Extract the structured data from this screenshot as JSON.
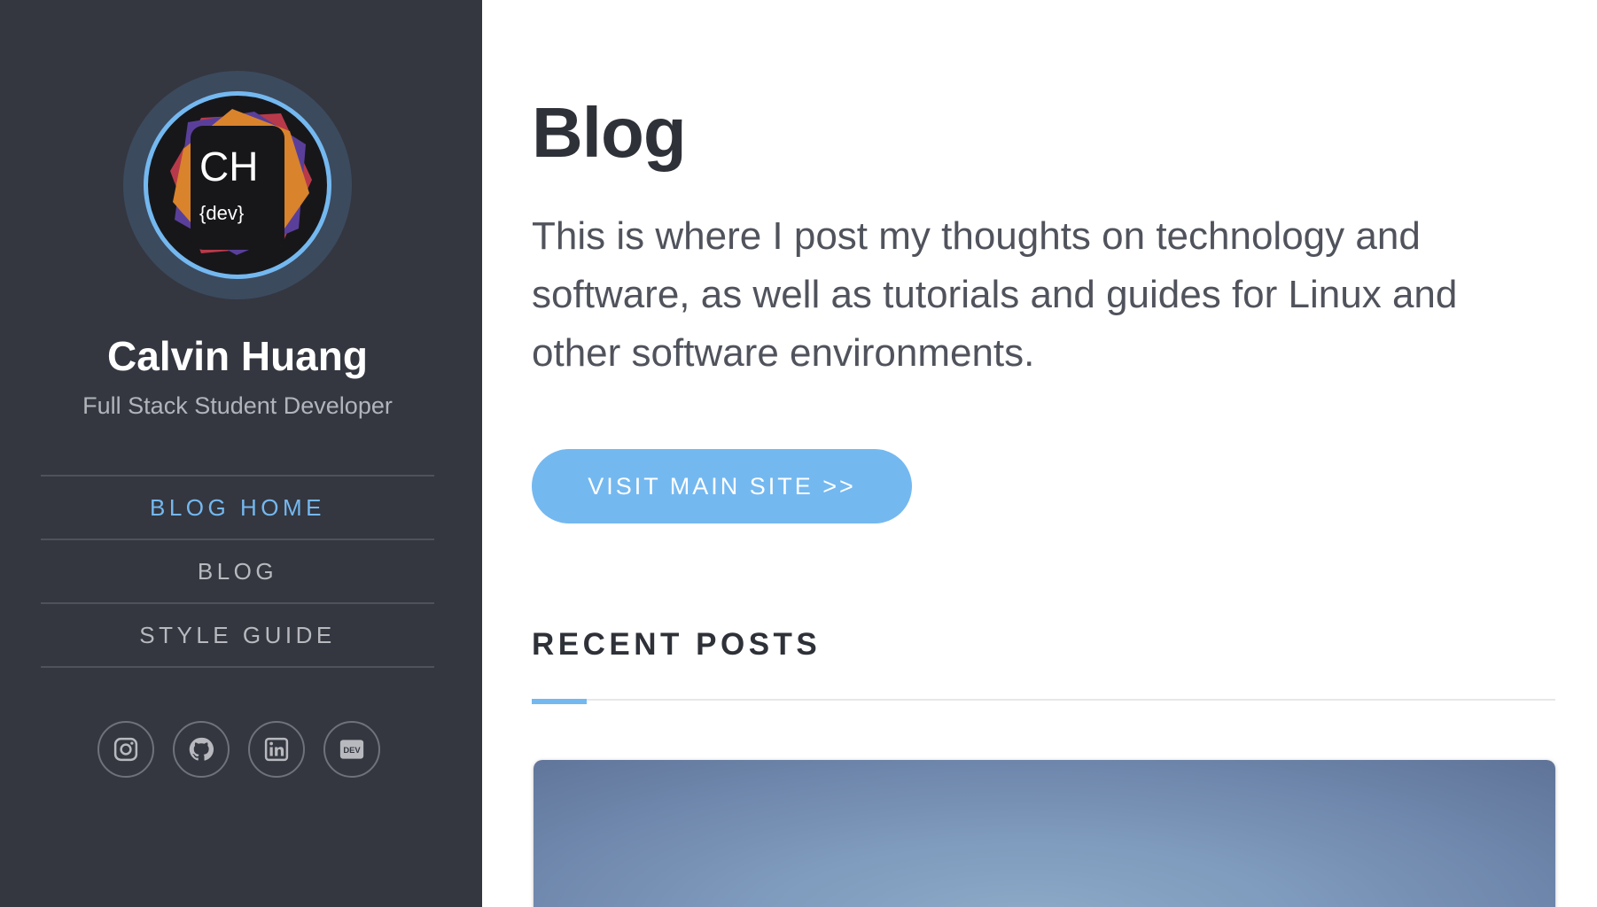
{
  "profile": {
    "logo_text": "CH",
    "logo_subtext": "{dev}",
    "name": "Calvin Huang",
    "tagline": "Full Stack Student Developer"
  },
  "nav": {
    "items": [
      {
        "label": "BLOG HOME",
        "active": true
      },
      {
        "label": "BLOG",
        "active": false
      },
      {
        "label": "STYLE GUIDE",
        "active": false
      }
    ]
  },
  "social": {
    "icons": [
      "instagram-icon",
      "github-icon",
      "linkedin-icon",
      "dev-icon"
    ],
    "dev_label": "DEV"
  },
  "main": {
    "title": "Blog",
    "intro": "This is where I post my thoughts on technology and software, as well as tutorials and guides for Linux and other software environments.",
    "cta_label": "VISIT MAIN SITE >>",
    "section_title": "RECENT POSTS"
  },
  "colors": {
    "sidebar_bg": "#343740",
    "accent": "#74b8f0",
    "heading": "#2f3139",
    "body_text": "#50535c"
  }
}
